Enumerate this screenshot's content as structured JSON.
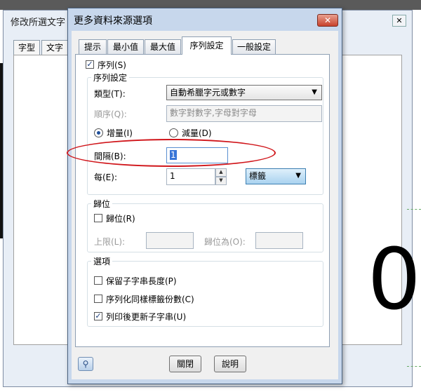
{
  "background_window": {
    "title": "修改所選文字",
    "close": "✕",
    "tabs": [
      "字型",
      "文字"
    ]
  },
  "big_digit": "0",
  "dialog": {
    "title": "更多資料來源選項",
    "close": "✕",
    "tabs": [
      "提示",
      "最小值",
      "最大值",
      "序列設定",
      "一般設定"
    ],
    "active_tab": "序列設定",
    "serial_checkbox": {
      "label": "序列(S)",
      "checked": true
    },
    "serial_group": {
      "legend": "序列設定",
      "type_label": "類型(T):",
      "type_value": "自動希臘字元或數字",
      "order_label": "順序(Q):",
      "order_value": "數字對數字,字母對字母",
      "increment_label": "增量(I)",
      "decrement_label": "減量(D)",
      "interval_label": "間隔(B):",
      "interval_value": "1",
      "every_label": "每(E):",
      "every_value": "1",
      "every_unit": "標籤"
    },
    "reset_group": {
      "legend": "歸位",
      "reset_checkbox": "歸位(R)",
      "upper_label": "上限(L):",
      "reset_to_label": "歸位為(O):"
    },
    "options_group": {
      "legend": "選項",
      "keep_length": {
        "label": "保留子字串長度(P)",
        "checked": false
      },
      "serialize_copies": {
        "label": "序列化同樣標籤份數(C)",
        "checked": false
      },
      "update_after_print": {
        "label": "列印後更新子字串(U)",
        "checked": true
      }
    },
    "buttons": {
      "close": "關閉",
      "help": "說明"
    },
    "highlight_color": "#d0151a"
  }
}
